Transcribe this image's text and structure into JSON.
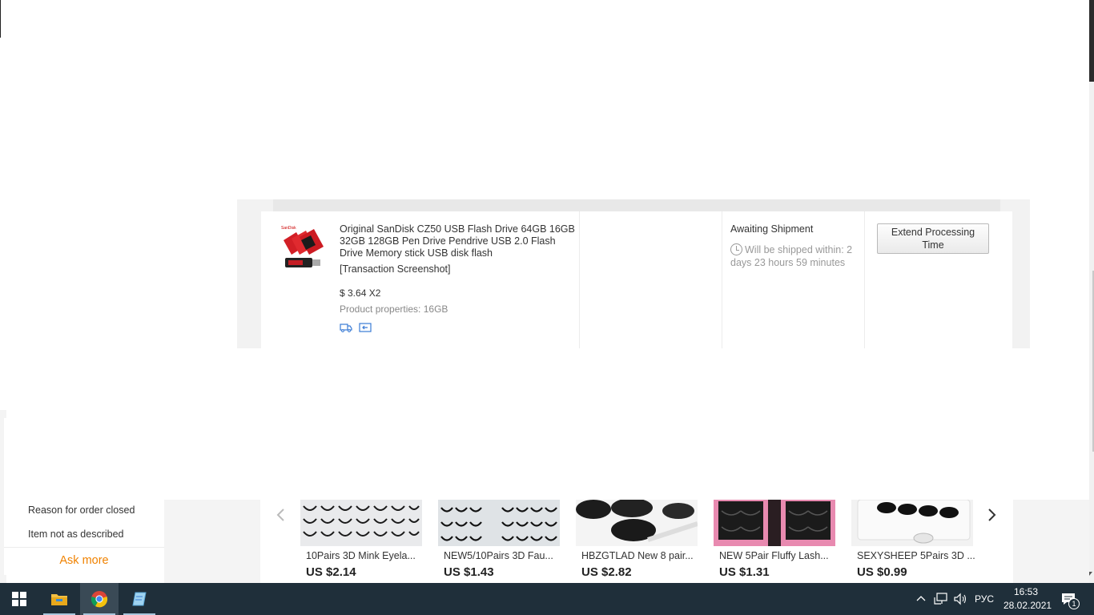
{
  "order": {
    "product_title": "Original SanDisk CZ50 USB Flash Drive 64GB 16GB 32GB 128GB Pen Drive Pendrive USB 2.0 Flash Drive Memory stick USB disk flash",
    "transaction_link": "[Transaction Screenshot]",
    "price": "$ 3.64 X2",
    "properties": "Product properties: 16GB",
    "status": "Awaiting Shipment",
    "ship_time": "Will be shipped within: 2 days 23 hours 59 minutes",
    "extend_button": "Extend Processing Time",
    "thumb_brand": "SanDisk"
  },
  "reason_box": {
    "label": "Reason for order closed",
    "value": "Item not as described",
    "ask_more": "Ask more"
  },
  "recommendations": [
    {
      "name": "10Pairs 3D Mink Eyela...",
      "price": "US $2.14"
    },
    {
      "name": "NEW5/10Pairs 3D Fau...",
      "price": "US $1.43"
    },
    {
      "name": "HBZGTLAD New 8 pair...",
      "price": "US $2.82"
    },
    {
      "name": "NEW 5Pair Fluffy Lash...",
      "price": "US $1.31"
    },
    {
      "name": "SEXYSHEEP 5Pairs 3D ...",
      "price": "US $0.99"
    }
  ],
  "taskbar": {
    "language": "РУС",
    "time": "16:53",
    "date": "28.02.2021",
    "notification_count": "1"
  },
  "icons": [
    "windows-start-icon",
    "file-explorer-icon",
    "chrome-icon",
    "notepad-icon",
    "chevron-up-icon",
    "network-icon",
    "volume-icon",
    "notification-icon",
    "clock-icon",
    "shipping-icon",
    "return-icon",
    "arrow-left-icon",
    "arrow-right-icon"
  ],
  "colors": {
    "accent": "#f08200",
    "taskbar": "#1f2f3a"
  }
}
